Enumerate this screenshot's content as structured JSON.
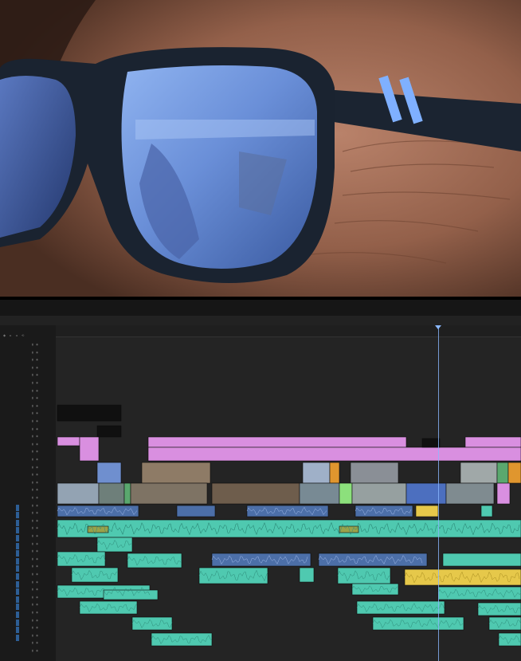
{
  "photo": {
    "subject_icon": "sunglasses-closeup-image",
    "colors": {
      "skin": "#a06a4c",
      "frame": "#1a2330",
      "lens": "#6a8fd8",
      "stripe": "#7fb0ff"
    }
  },
  "editor": {
    "top_bar_items": [
      "",
      "",
      "",
      "",
      "",
      ""
    ],
    "panel_tabs": [
      {
        "label": "",
        "active": false
      },
      {
        "label": "",
        "active": false
      },
      {
        "label": "",
        "active": true
      }
    ],
    "timecode": "",
    "ruler_ticks": [
      "",
      "",
      "",
      "",
      "",
      "",
      "",
      "",
      "",
      "",
      "",
      "",
      "",
      "",
      "",
      "",
      "",
      "",
      ""
    ],
    "clip_colors": {
      "video_pink": "#d98fe0",
      "video_blue": "#6f8fcf",
      "audio_teal": "#4fc9b0",
      "audio_green": "#5aa86e",
      "audio_yellow": "#e6c84a",
      "audio_blue": "#4c6fa8",
      "orange": "#e0962e",
      "olive": "#9aa24a",
      "black": "#101010"
    },
    "playhead_color": "#8ab8ff"
  }
}
